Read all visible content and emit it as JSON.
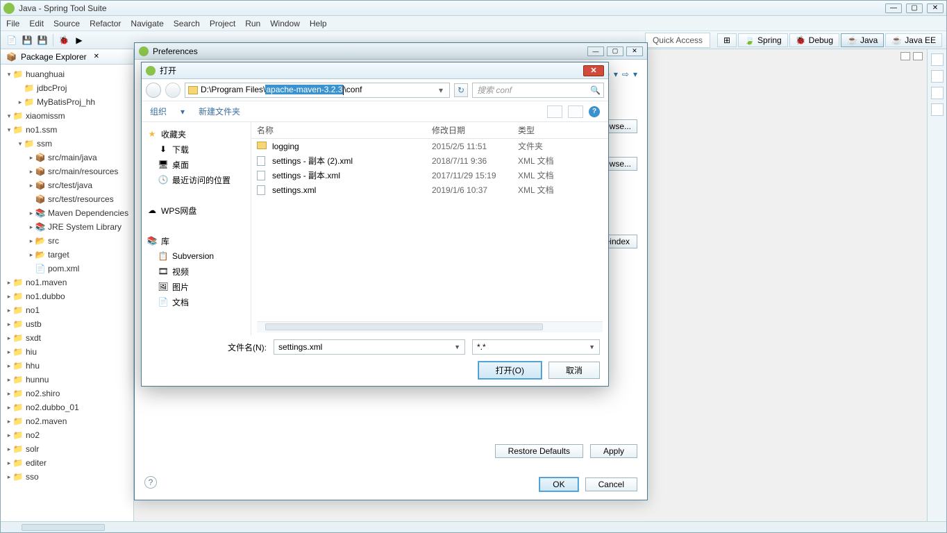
{
  "window_title": "Java - Spring Tool Suite",
  "menus": [
    "File",
    "Edit",
    "Source",
    "Refactor",
    "Navigate",
    "Search",
    "Project",
    "Run",
    "Window",
    "Help"
  ],
  "quick_access": "Quick Access",
  "perspectives": [
    {
      "label": "Spring"
    },
    {
      "label": "Debug"
    },
    {
      "label": "Java",
      "active": true
    },
    {
      "label": "Java EE"
    }
  ],
  "package_explorer": {
    "title": "Package Explorer",
    "tree": [
      {
        "label": "huanghuai",
        "icon": "project",
        "indent": 0,
        "twist": "▾"
      },
      {
        "label": "jdbcProj",
        "icon": "folder-closed",
        "indent": 1,
        "twist": ""
      },
      {
        "label": "MyBatisProj_hh",
        "icon": "project-maven",
        "indent": 1,
        "twist": "▸"
      },
      {
        "label": "xiaomissm",
        "icon": "project",
        "indent": 0,
        "twist": "▾"
      },
      {
        "label": "no1.ssm",
        "icon": "project",
        "indent": 0,
        "twist": "▾"
      },
      {
        "label": "ssm",
        "icon": "project-maven",
        "indent": 1,
        "twist": "▾"
      },
      {
        "label": "src/main/java",
        "icon": "pkg",
        "indent": 2,
        "twist": "▸"
      },
      {
        "label": "src/main/resources",
        "icon": "pkg",
        "indent": 2,
        "twist": "▸"
      },
      {
        "label": "src/test/java",
        "icon": "pkg",
        "indent": 2,
        "twist": "▸"
      },
      {
        "label": "src/test/resources",
        "icon": "pkg",
        "indent": 2,
        "twist": ""
      },
      {
        "label": "Maven Dependencies",
        "icon": "lib",
        "indent": 2,
        "twist": "▸"
      },
      {
        "label": "JRE System Library",
        "icon": "lib",
        "indent": 2,
        "twist": "▸"
      },
      {
        "label": "src",
        "icon": "folder",
        "indent": 2,
        "twist": "▸"
      },
      {
        "label": "target",
        "icon": "folder",
        "indent": 2,
        "twist": "▸"
      },
      {
        "label": "pom.xml",
        "icon": "file-maven",
        "indent": 2,
        "twist": ""
      },
      {
        "label": "no1.maven",
        "icon": "project",
        "indent": 0,
        "twist": "▸"
      },
      {
        "label": "no1.dubbo",
        "icon": "project",
        "indent": 0,
        "twist": "▸"
      },
      {
        "label": "no1",
        "icon": "project",
        "indent": 0,
        "twist": "▸"
      },
      {
        "label": "ustb",
        "icon": "project",
        "indent": 0,
        "twist": "▸"
      },
      {
        "label": "sxdt",
        "icon": "project",
        "indent": 0,
        "twist": "▸"
      },
      {
        "label": "hiu",
        "icon": "project",
        "indent": 0,
        "twist": "▸"
      },
      {
        "label": "hhu",
        "icon": "project",
        "indent": 0,
        "twist": "▸"
      },
      {
        "label": "hunnu",
        "icon": "project",
        "indent": 0,
        "twist": "▸"
      },
      {
        "label": "no2.shiro",
        "icon": "project",
        "indent": 0,
        "twist": "▸"
      },
      {
        "label": "no2.dubbo_01",
        "icon": "project",
        "indent": 0,
        "twist": "▸"
      },
      {
        "label": "no2.maven",
        "icon": "project",
        "indent": 0,
        "twist": "▸"
      },
      {
        "label": "no2",
        "icon": "project",
        "indent": 0,
        "twist": "▸"
      },
      {
        "label": "solr",
        "icon": "project",
        "indent": 0,
        "twist": "▸"
      },
      {
        "label": "editer",
        "icon": "project",
        "indent": 0,
        "twist": "▸"
      },
      {
        "label": "sso",
        "icon": "project",
        "indent": 0,
        "twist": "▸"
      }
    ]
  },
  "preferences": {
    "title": "Preferences",
    "browse": "Browse...",
    "reindex": "Reindex",
    "restore_defaults": "Restore Defaults",
    "apply": "Apply",
    "ok": "OK",
    "cancel": "Cancel"
  },
  "file_dialog": {
    "title": "打开",
    "path_prefix": "D:\\Program Files\\",
    "path_selected": "apache-maven-3.2.3",
    "path_suffix": "\\conf",
    "search_placeholder": "搜索 conf",
    "organize": "组织",
    "new_folder": "新建文件夹",
    "cols": {
      "name": "名称",
      "date": "修改日期",
      "type": "类型"
    },
    "sidebar": [
      {
        "label": "收藏夹",
        "icon": "star",
        "indent": 0
      },
      {
        "label": "下载",
        "icon": "download",
        "indent": 1
      },
      {
        "label": "桌面",
        "icon": "desktop",
        "indent": 1
      },
      {
        "label": "最近访问的位置",
        "icon": "recent",
        "indent": 1
      },
      {
        "label": "",
        "icon": "",
        "indent": 0
      },
      {
        "label": "WPS网盘",
        "icon": "cloud",
        "indent": 0
      },
      {
        "label": "",
        "icon": "",
        "indent": 0
      },
      {
        "label": "库",
        "icon": "library",
        "indent": 0
      },
      {
        "label": "Subversion",
        "icon": "svn",
        "indent": 1
      },
      {
        "label": "视频",
        "icon": "video",
        "indent": 1
      },
      {
        "label": "图片",
        "icon": "image",
        "indent": 1
      },
      {
        "label": "文档",
        "icon": "doc",
        "indent": 1
      }
    ],
    "files": [
      {
        "name": "logging",
        "date": "2015/2/5 11:51",
        "type": "文件夹",
        "icon": "folder"
      },
      {
        "name": "settings - 副本 (2).xml",
        "date": "2018/7/11 9:36",
        "type": "XML 文档",
        "icon": "xml"
      },
      {
        "name": "settings - 副本.xml",
        "date": "2017/11/29 15:19",
        "type": "XML 文档",
        "icon": "xml"
      },
      {
        "name": "settings.xml",
        "date": "2019/1/6 10:37",
        "type": "XML 文档",
        "icon": "xml"
      }
    ],
    "filename_label": "文件名(N):",
    "filename_value": "settings.xml",
    "filter": "*.*",
    "open": "打开(O)",
    "cancel": "取消"
  }
}
